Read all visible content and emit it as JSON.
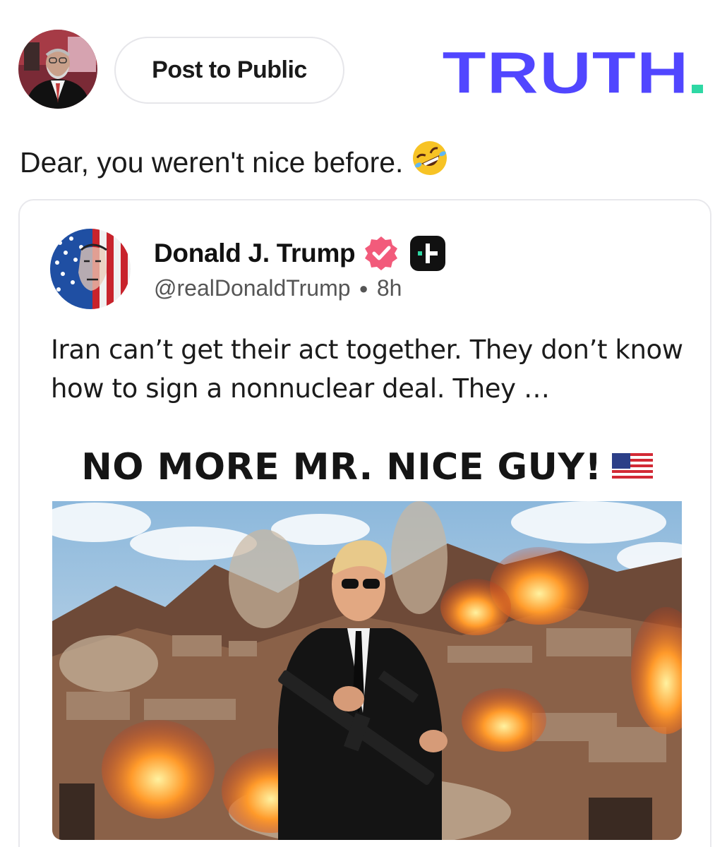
{
  "header": {
    "post_button_label": "Post to Public",
    "logo_text": "TRUTH"
  },
  "comment": {
    "text": "Dear, you weren't nice before."
  },
  "quoted_post": {
    "author_name": "Donald J. Trump",
    "handle": "@realDonaldTrump",
    "time": "8h",
    "body": "Iran can’t get their act together. They don’t know how to sign a nonnuclear deal. They …",
    "image_headline": "NO MORE MR. NICE GUY!"
  },
  "icons": {
    "verified": "verified-badge-icon",
    "plus": "plus-badge-icon",
    "emoji": "rolling-on-floor-laughing-emoji",
    "flag": "us-flag-emoji"
  },
  "colors": {
    "logo": "#5146ff",
    "logo_accent": "#2ed8a4",
    "verified": "#f25b7b",
    "border": "#e8e8ec"
  }
}
